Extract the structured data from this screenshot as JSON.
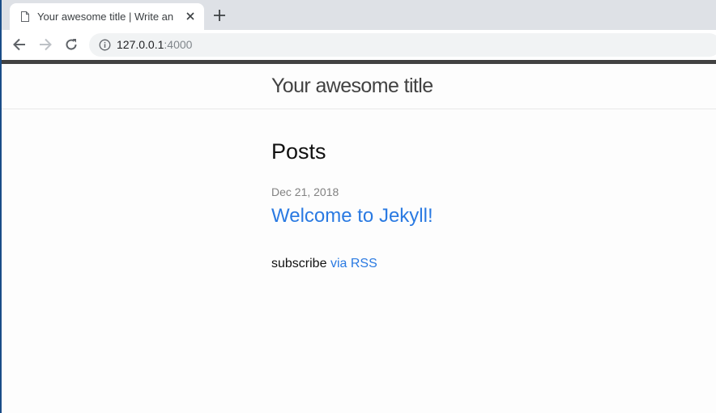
{
  "browser": {
    "tab_title": "Your awesome title | Write an awesome description for your new site here.",
    "url_host": "127.0.0.1",
    "url_port": ":4000"
  },
  "icons": {
    "tab_favicon": "document-icon",
    "tab_close": "close-icon",
    "new_tab": "plus-icon",
    "back": "back-arrow-icon",
    "forward": "forward-arrow-icon",
    "reload": "reload-icon",
    "site_info": "info-icon"
  },
  "site": {
    "title": "Your awesome title",
    "heading": "Posts",
    "posts": [
      {
        "date": "Dec 21, 2018",
        "title": "Welcome to Jekyll!"
      }
    ],
    "subscribe_text": "subscribe",
    "rss_link": "via RSS"
  },
  "colors": {
    "link": "#2a7ae2",
    "meta": "#828282",
    "text": "#111111",
    "header_text": "#424242",
    "topbar": "#424242",
    "page_bg": "#fdfdfd"
  }
}
